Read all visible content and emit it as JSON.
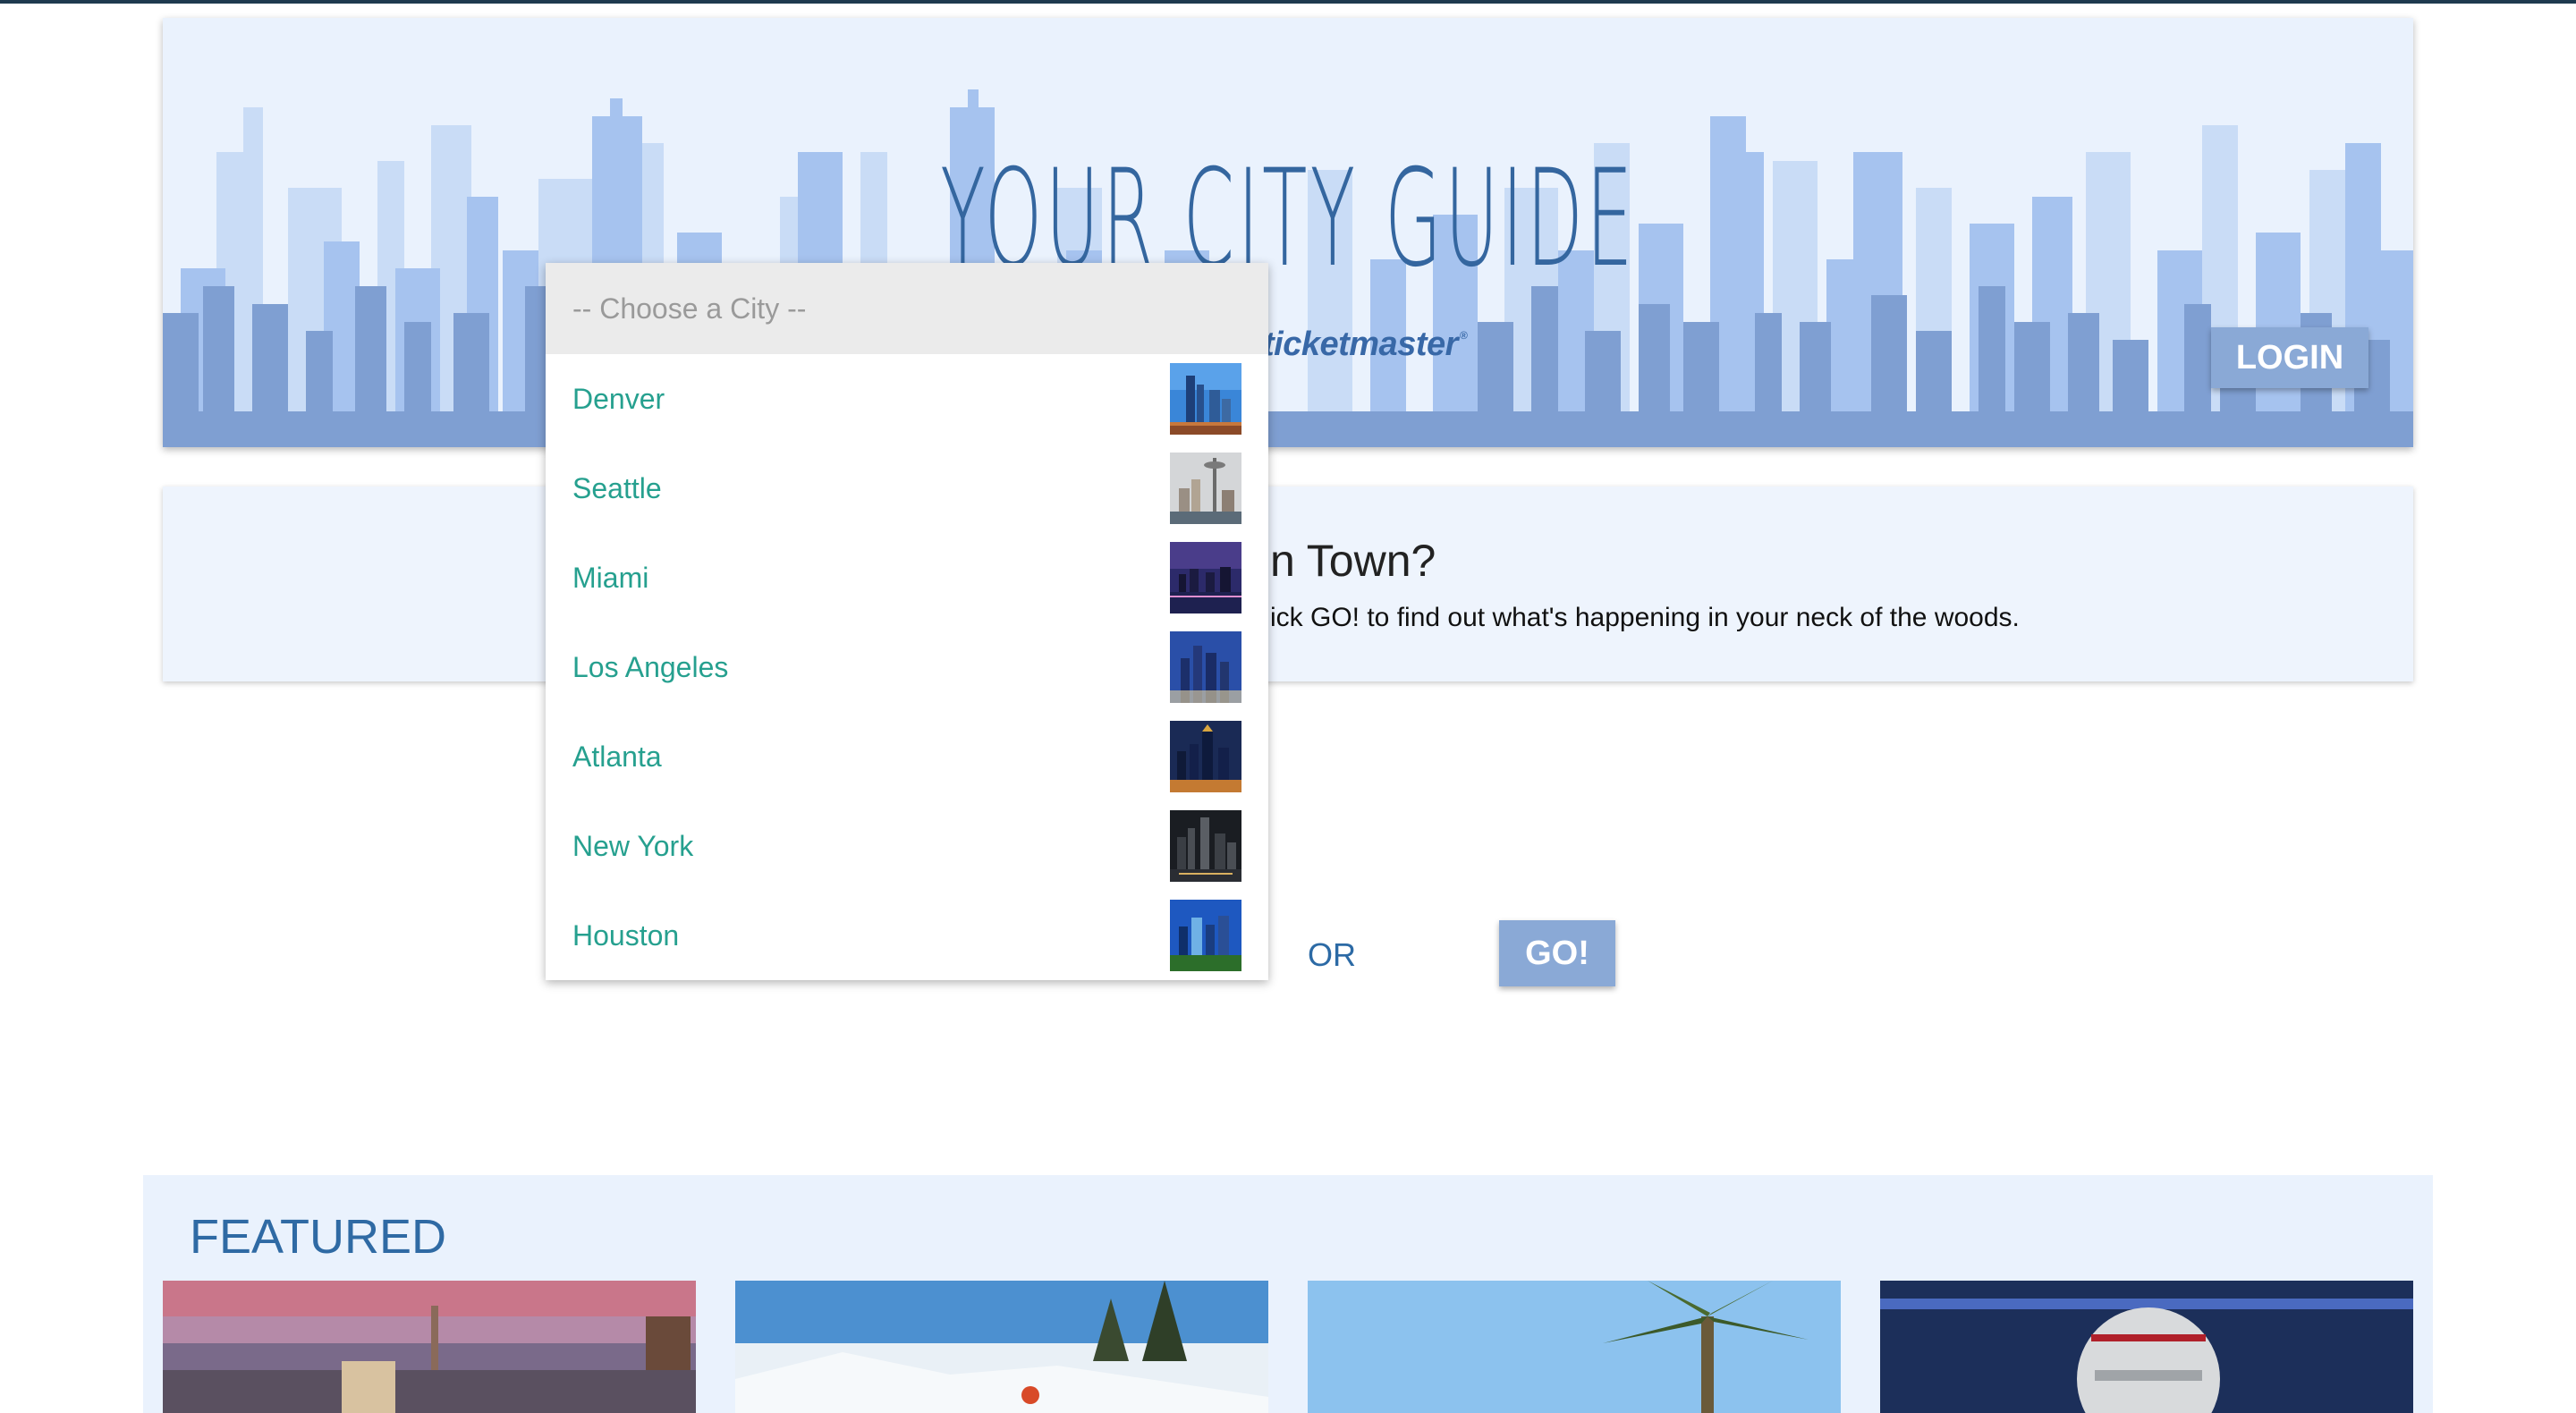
{
  "hero": {
    "title": "YOUR CITY GUIDE",
    "brand": "ticketmaster",
    "brand_mark": "®",
    "login_label": "LOGIN"
  },
  "intro": {
    "heading_visible": "n Town?",
    "text_visible": "ick GO! to find out what's happening in your neck of the woods."
  },
  "city_select": {
    "placeholder": "-- Choose a City --",
    "options": [
      {
        "label": "Denver",
        "thumb_icon": "denver-skyline-thumbnail"
      },
      {
        "label": "Seattle",
        "thumb_icon": "seattle-skyline-thumbnail"
      },
      {
        "label": "Miami",
        "thumb_icon": "miami-skyline-thumbnail"
      },
      {
        "label": "Los Angeles",
        "thumb_icon": "los-angeles-skyline-thumbnail"
      },
      {
        "label": "Atlanta",
        "thumb_icon": "atlanta-skyline-thumbnail"
      },
      {
        "label": "New York",
        "thumb_icon": "new-york-skyline-thumbnail"
      },
      {
        "label": "Houston",
        "thumb_icon": "houston-skyline-thumbnail"
      }
    ]
  },
  "actions": {
    "or_label": "OR",
    "go_label": "GO!"
  },
  "featured": {
    "title": "FEATURED",
    "cards": [
      {
        "image": "city-skyline-sunset-photo"
      },
      {
        "image": "skier-snow-photo"
      },
      {
        "image": "palm-tree-photo"
      },
      {
        "image": "football-player-helmet-photo"
      }
    ]
  },
  "colors": {
    "accent_blue": "#34669f",
    "button_blue": "#8aa9d6",
    "city_link_green": "#26a08f",
    "hero_bg": "#eaf2fd"
  }
}
